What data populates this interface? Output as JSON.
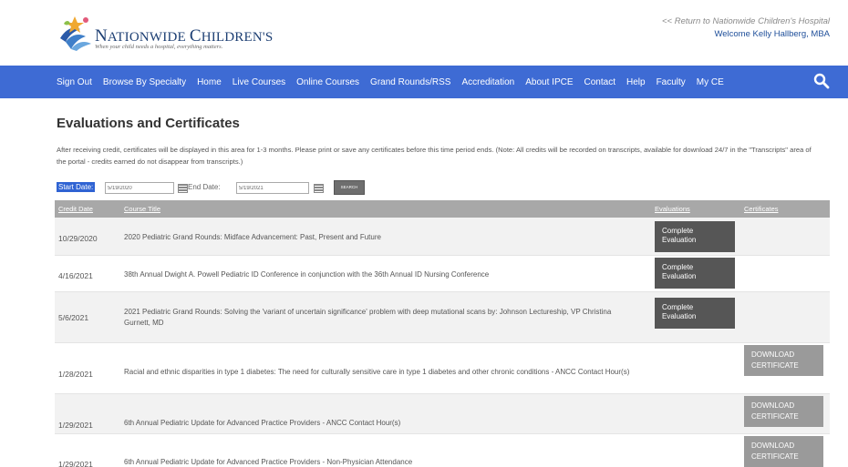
{
  "header": {
    "logo": {
      "name_big_1": "N",
      "name_rest_1": "ATIONWIDE ",
      "name_big_2": "C",
      "name_rest_2": "HILDREN'S",
      "tagline": "When your child needs a hospital, everything matters."
    },
    "return_link": "<< Return to Nationwide Children's Hospital",
    "welcome": "Welcome Kelly Hallberg, MBA"
  },
  "nav": {
    "items": [
      "Sign Out",
      "Browse By Specialty",
      "Home",
      "Live Courses",
      "Online Courses",
      "Grand Rounds/RSS",
      "Accreditation",
      "About IPCE",
      "Contact",
      "Help",
      "Faculty",
      "My CE"
    ],
    "search_icon": "search-icon"
  },
  "main": {
    "title": "Evaluations and Certificates",
    "intro": "After receiving credit, certificates will be displayed in this area for 1-3 months.  Please print or save any certificates before this time period ends.  (Note: All credits will be recorded on transcripts, available for download 24/7 in the \"Transcripts\" area of the portal - credits earned do not disappear from transcripts.)",
    "filters": {
      "start_label": "Start Date:",
      "start_value": "5/19/2020",
      "end_label": "End Date:",
      "end_value": "5/19/2021",
      "search_label": "SEARCH"
    },
    "table": {
      "headers": [
        "Credit Date",
        "Course Title",
        "Evaluations",
        "Certificates"
      ],
      "rows": [
        {
          "date": "10/29/2020",
          "title": "2020 Pediatric Grand Rounds: Midface Advancement: Past, Present and Future",
          "evaluation": "Complete\nEvaluation",
          "certificate": ""
        },
        {
          "date": "4/16/2021",
          "title": "38th Annual Dwight A. Powell Pediatric ID Conference in conjunction with the 36th Annual ID Nursing Conference",
          "evaluation": "Complete\nEvaluation",
          "certificate": ""
        },
        {
          "date": "5/6/2021",
          "title": "2021 Pediatric Grand Rounds: Solving the 'variant of uncertain significance' problem with deep mutational scans by: Johnson Lectureship, VP Christina Gurnett, MD",
          "evaluation": "Complete\nEvaluation",
          "certificate": ""
        },
        {
          "date": "1/28/2021",
          "title": "Racial and ethnic disparities in type 1 diabetes: The need for culturally sensitive care in type 1 diabetes and other chronic conditions - ANCC Contact Hour(s)",
          "evaluation": "",
          "certificate": "DOWNLOAD\nCERTIFICATE"
        },
        {
          "date": "1/29/2021",
          "title": "6th Annual Pediatric Update for Advanced Practice Providers - ANCC Contact Hour(s)",
          "evaluation": "",
          "certificate": "DOWNLOAD\nCERTIFICATE"
        },
        {
          "date": "1/29/2021",
          "title": "6th Annual Pediatric Update for Advanced Practice Providers - Non-Physician Attendance",
          "evaluation": "",
          "certificate": "DOWNLOAD\nCERTIFICATE"
        }
      ]
    }
  },
  "colors": {
    "nav_bg": "#3e6bd4",
    "header_row": "#a8a8a8",
    "eval_button": "#565656",
    "cert_button": "#9a9a9a",
    "brand_navy": "#1d3f73"
  }
}
